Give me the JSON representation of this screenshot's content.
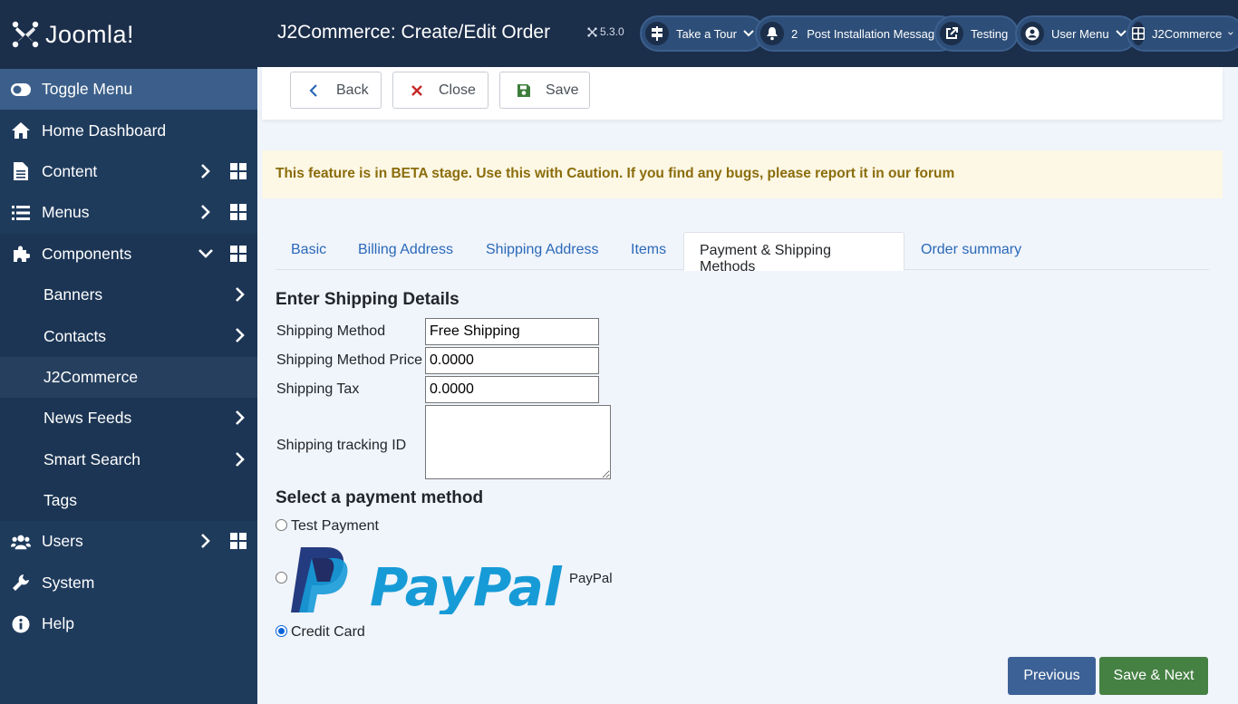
{
  "brand": {
    "name": "Joomla!"
  },
  "sidebar": {
    "items": [
      {
        "label": "Toggle Menu",
        "icon": "toggle-icon"
      },
      {
        "label": "Home Dashboard",
        "icon": "home-icon"
      },
      {
        "label": "Content",
        "icon": "file-icon"
      },
      {
        "label": "Menus",
        "icon": "list-icon"
      },
      {
        "label": "Components",
        "icon": "puzzle-icon"
      },
      {
        "label": "Banners"
      },
      {
        "label": "Contacts"
      },
      {
        "label": "J2Commerce"
      },
      {
        "label": "News Feeds"
      },
      {
        "label": "Smart Search"
      },
      {
        "label": "Tags"
      },
      {
        "label": "Users",
        "icon": "users-icon"
      },
      {
        "label": "System",
        "icon": "wrench-icon"
      },
      {
        "label": "Help",
        "icon": "info-icon"
      }
    ]
  },
  "header": {
    "title": "J2Commerce: Create/Edit Order",
    "version": "5.3.0",
    "buttons": [
      {
        "label": "Take a Tour",
        "icon": "signpost-icon"
      },
      {
        "label": "Post Installation Messages",
        "icon": "bell-icon",
        "count": "2"
      },
      {
        "label": "Testing",
        "icon": "external-link-icon"
      },
      {
        "label": "User Menu",
        "icon": "user-icon"
      },
      {
        "label": "J2Commerce",
        "icon": "grid-icon"
      }
    ]
  },
  "toolbar": {
    "back_label": "Back",
    "close_label": "Close",
    "save_label": "Save"
  },
  "alert": {
    "text": "This feature is in BETA stage. Use this with Caution. If you find any bugs, please report it in our forum"
  },
  "tabs": [
    {
      "label": "Basic"
    },
    {
      "label": "Billing Address"
    },
    {
      "label": "Shipping Address"
    },
    {
      "label": "Items"
    },
    {
      "label": "Payment & Shipping Methods",
      "active": true
    },
    {
      "label": "Order summary"
    }
  ],
  "shipping": {
    "title": "Enter Shipping Details",
    "method_label": "Shipping Method",
    "method_value": "Free Shipping",
    "price_label": "Shipping Method Price",
    "price_value": "0.0000",
    "tax_label": "Shipping Tax",
    "tax_value": "0.0000",
    "tracking_label": "Shipping tracking ID",
    "tracking_value": ""
  },
  "payment": {
    "title": "Select a payment method",
    "options": [
      {
        "label": "Test Payment",
        "checked": false
      },
      {
        "label": "PayPal",
        "checked": false,
        "logo_text": "PayPal"
      },
      {
        "label": "Credit Card",
        "checked": true
      }
    ]
  },
  "footer": {
    "previous_label": "Previous",
    "save_next_label": "Save & Next"
  },
  "colors": {
    "sidebar_bg": "#1f3b5c",
    "header_bg": "#1b2e4a",
    "previous_bg": "#3c6196",
    "save_next_bg": "#468144",
    "alert_text": "#8a6d0c",
    "link": "#2a69b8"
  }
}
